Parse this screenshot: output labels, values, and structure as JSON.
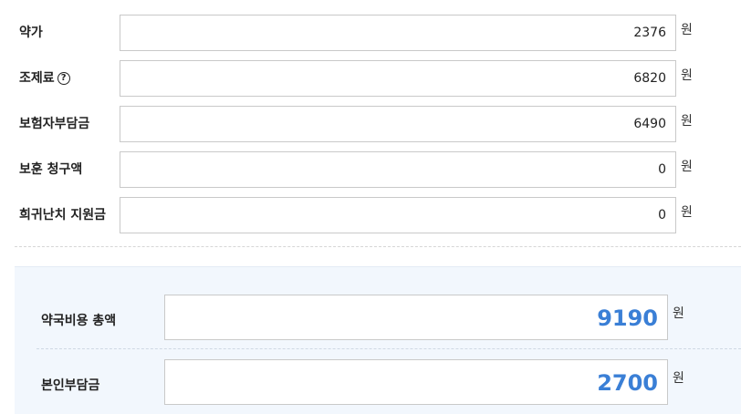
{
  "unit": "원",
  "items": [
    {
      "label": "약가",
      "value": "2376"
    },
    {
      "label": "조제료",
      "value": "6820",
      "help": "?"
    },
    {
      "label": "보험자부담금",
      "value": "6490"
    },
    {
      "label": "보훈 청구액",
      "value": "0"
    },
    {
      "label": "희귀난치 지원금",
      "value": "0"
    }
  ],
  "summary": {
    "total_label": "약국비용 총액",
    "total_value": "9190",
    "copay_label": "본인부담금",
    "copay_value": "2700"
  },
  "colors": {
    "accent": "#3a7fd6",
    "summary_background": "#f2f7fd"
  }
}
